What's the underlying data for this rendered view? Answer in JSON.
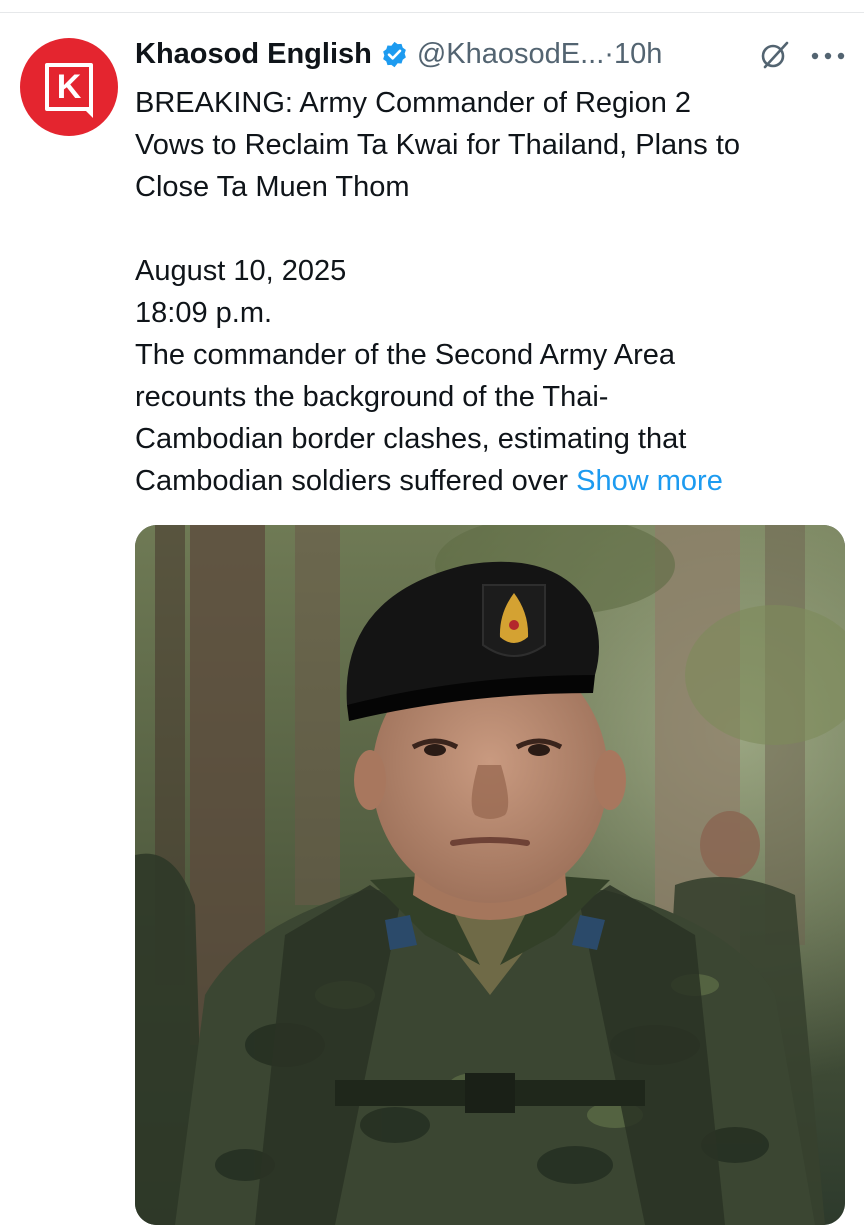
{
  "tweet": {
    "author": {
      "name": "Khaosod English",
      "handle": "@KhaosodE...",
      "verified": true,
      "avatar_letter": "K",
      "avatar_color": "#e4252f"
    },
    "separator": " · ",
    "time": "10h",
    "icons": {
      "grok": "grok-icon",
      "more": "more-icon"
    },
    "text": {
      "line1": "BREAKING: Army Commander of Region 2",
      "line2": "Vows to Reclaim Ta Kwai for Thailand, Plans to",
      "line3": "Close Ta Muen Thom",
      "date": "August 10, 2025",
      "clock": "18:09 p.m.",
      "body1": "The commander of the Second Army Area",
      "body2": "recounts the background of the Thai-",
      "body3": "Cambodian border clashes, estimating that",
      "body4": "Cambodian soldiers suffered over",
      "show_more": "Show more"
    },
    "media": {
      "type": "photo",
      "subject": "soldier-portrait"
    }
  },
  "colors": {
    "link": "#1d9bf0",
    "secondary_text": "#536471",
    "verified_badge": "#1d9bf0"
  }
}
